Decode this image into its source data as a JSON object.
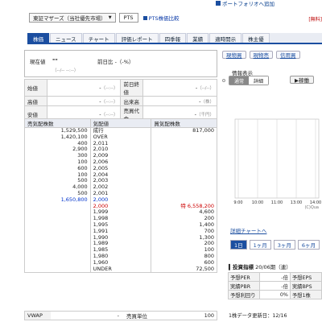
{
  "header": {
    "portfolio_label": "ポートフォリオへ追加",
    "free_label": "[無料]",
    "market_select": "東証マザーズ（当社優先市場）",
    "pts_button": "PTS",
    "pts_compare": "PTS株価比較"
  },
  "tabs": [
    {
      "label": "株価",
      "active": true
    },
    {
      "label": "ニュース"
    },
    {
      "label": "チャート"
    },
    {
      "label": "評価レポート"
    },
    {
      "label": "四季報"
    },
    {
      "label": "業績"
    },
    {
      "label": "適時開示"
    },
    {
      "label": "株主優"
    }
  ],
  "price": {
    "label": "現在値",
    "value": "--",
    "change": "前日比 -（-%）",
    "time": "（--/-- --:--）"
  },
  "summary": [
    {
      "k1": "始値",
      "v1": "-",
      "t1": "（--:--）",
      "k2": "前日終値",
      "v2": "-",
      "t2": "（--/--）"
    },
    {
      "k1": "高値",
      "v1": "-",
      "t1": "（--:--）",
      "k2": "出来高",
      "v2": "-",
      "t2": "（株）"
    },
    {
      "k1": "安値",
      "v1": "-",
      "t1": "（--:--）",
      "k2": "売買代金",
      "v2": "-",
      "t2": "（千円）"
    }
  ],
  "board": {
    "headers": {
      "sell": "売気配株数",
      "price": "気配値",
      "buy": "買気配株数"
    },
    "rows": [
      {
        "sell": "1,529,500",
        "price": "成行",
        "buy": "817,000"
      },
      {
        "sell": "1,420,100",
        "price": "OVER",
        "buy": ""
      },
      {
        "sell": "400",
        "price": "2,011",
        "buy": ""
      },
      {
        "sell": "2,900",
        "price": "2,010",
        "buy": ""
      },
      {
        "sell": "300",
        "price": "2,009",
        "buy": ""
      },
      {
        "sell": "100",
        "price": "2,006",
        "buy": ""
      },
      {
        "sell": "600",
        "price": "2,005",
        "buy": ""
      },
      {
        "sell": "100",
        "price": "2,004",
        "buy": ""
      },
      {
        "sell": "500",
        "price": "2,003",
        "buy": ""
      },
      {
        "sell": "4,000",
        "price": "2,002",
        "buy": ""
      },
      {
        "sell": "500",
        "price": "2,001",
        "buy": ""
      },
      {
        "sell": "1,650,800",
        "price": "2,000",
        "buy": "",
        "style": "blue"
      },
      {
        "sell": "",
        "price": "2,000",
        "buy": "特 6,558,200",
        "style": "red"
      },
      {
        "sell": "",
        "price": "1,999",
        "buy": "4,600"
      },
      {
        "sell": "",
        "price": "1,998",
        "buy": "200"
      },
      {
        "sell": "",
        "price": "1,995",
        "buy": "1,400"
      },
      {
        "sell": "",
        "price": "1,991",
        "buy": "700"
      },
      {
        "sell": "",
        "price": "1,990",
        "buy": "1,300"
      },
      {
        "sell": "",
        "price": "1,989",
        "buy": "200"
      },
      {
        "sell": "",
        "price": "1,985",
        "buy": "100"
      },
      {
        "sell": "",
        "price": "1,980",
        "buy": "800"
      },
      {
        "sell": "",
        "price": "1,960",
        "buy": "600"
      },
      {
        "sell": "",
        "price": "UNDER",
        "buy": "72,500"
      }
    ]
  },
  "vwap": {
    "label": "VWAP",
    "value": "-",
    "unit_label": "売買単位",
    "unit_value": "100"
  },
  "side": {
    "buttons": [
      "現物買",
      "現物売",
      "信用買"
    ],
    "info_title": "情報表示",
    "seg": [
      "通常",
      "詳細"
    ],
    "mark_btn": "▶稼働"
  },
  "chart_data": {
    "type": "line",
    "x_ticks": [
      "9:00",
      "10:00",
      "11:00",
      "13:00",
      "14:00"
    ],
    "credit": "(C)Qua",
    "series": []
  },
  "chart_link": "詳細チャートへ",
  "ranges": [
    {
      "label": "1日",
      "active": true
    },
    {
      "label": "1ヶ月"
    },
    {
      "label": "3ヶ月"
    },
    {
      "label": "6ヶ月"
    }
  ],
  "indicators": {
    "title": "投資指標",
    "period": "20/06期（連）",
    "rows": [
      {
        "k1": "予想PER",
        "v1": "-倍",
        "k2": "予想EPS"
      },
      {
        "k1": "実績PBR",
        "v1": "-倍",
        "k2": "実績BPS"
      },
      {
        "k1": "予想利回り",
        "v1": "0%",
        "k2": "予想1株"
      }
    ],
    "update": "1株データ更新日：12/16"
  }
}
